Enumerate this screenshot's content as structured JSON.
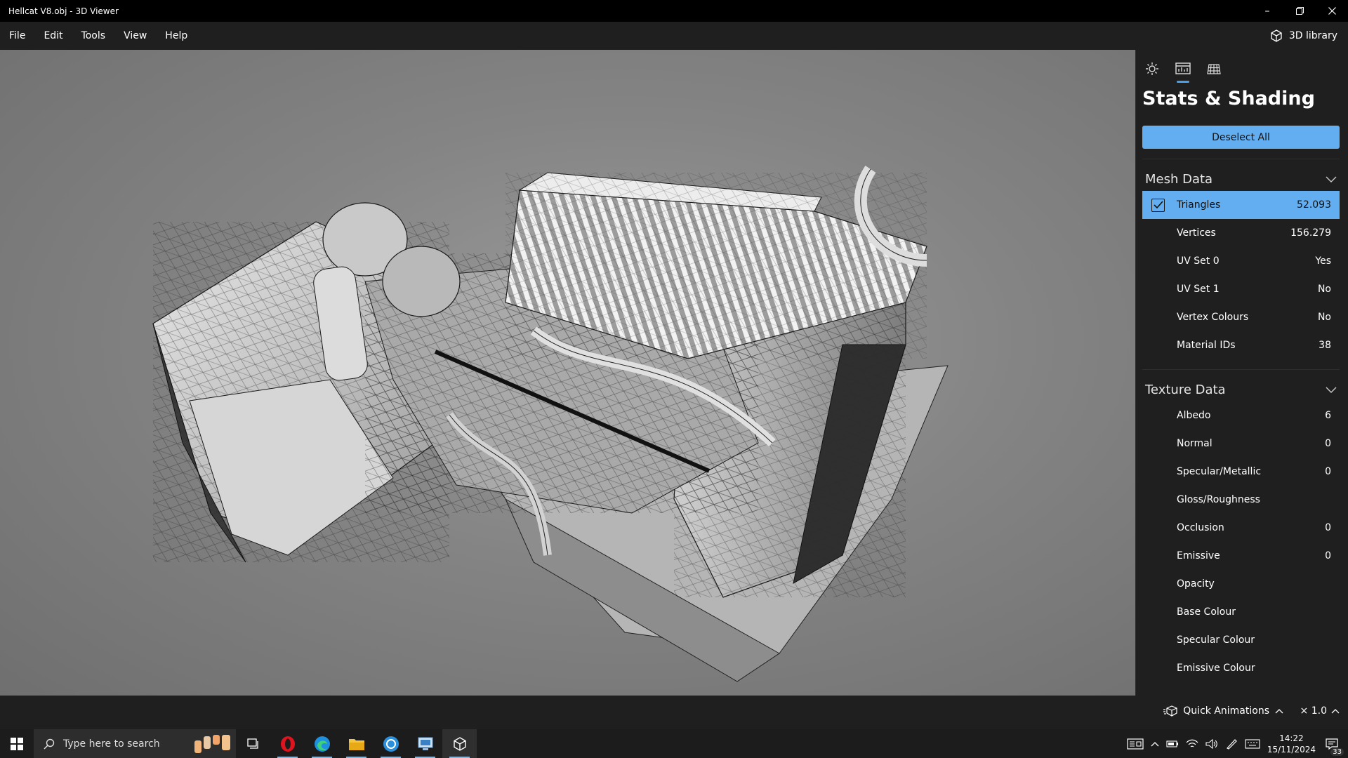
{
  "window": {
    "title": "Hellcat V8.obj - 3D Viewer"
  },
  "menu": {
    "items": [
      "File",
      "Edit",
      "Tools",
      "View",
      "Help"
    ],
    "library_label": "3D library"
  },
  "panel": {
    "title": "Stats & Shading",
    "deselect_label": "Deselect All",
    "mesh": {
      "header": "Mesh Data",
      "rows": [
        {
          "name": "Triangles",
          "value": "52.093",
          "selected": true
        },
        {
          "name": "Vertices",
          "value": "156.279"
        },
        {
          "name": "UV Set 0",
          "value": "Yes"
        },
        {
          "name": "UV Set 1",
          "value": "No"
        },
        {
          "name": "Vertex Colours",
          "value": "No"
        },
        {
          "name": "Material IDs",
          "value": "38"
        }
      ]
    },
    "texture": {
      "header": "Texture Data",
      "rows": [
        {
          "name": "Albedo",
          "value": "6"
        },
        {
          "name": "Normal",
          "value": "0"
        },
        {
          "name": "Specular/Metallic",
          "value": "0"
        },
        {
          "name": "Gloss/Roughness",
          "value": ""
        },
        {
          "name": "Occlusion",
          "value": "0"
        },
        {
          "name": "Emissive",
          "value": "0"
        },
        {
          "name": "Opacity",
          "value": ""
        },
        {
          "name": "Base Colour",
          "value": ""
        },
        {
          "name": "Specular Colour",
          "value": ""
        },
        {
          "name": "Emissive Colour",
          "value": ""
        }
      ]
    }
  },
  "bottom": {
    "quick_animations": "Quick Animations",
    "speed": "× 1.0"
  },
  "taskbar": {
    "search_placeholder": "Type here to search",
    "time": "14:22",
    "date": "15/11/2024",
    "notification_count": "33"
  },
  "colors": {
    "accent": "#62aef0",
    "titlebar": "#000000",
    "panel_bg": "#1f1f1f"
  }
}
